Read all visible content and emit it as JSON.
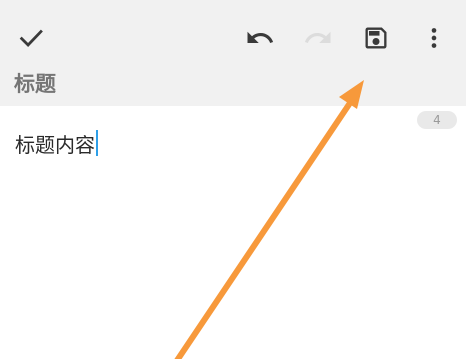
{
  "toolbar": {
    "done_icon": "checkmark-icon",
    "undo_icon": "undo-icon",
    "redo_icon": "redo-icon",
    "save_icon": "save-floppy-icon",
    "more_icon": "more-vertical-icon",
    "icon_color": "#3a3a3a",
    "disabled_icon_color": "#dcdcdc"
  },
  "note": {
    "title_placeholder": "标题",
    "content": "标题内容",
    "char_count": "4"
  },
  "annotation": {
    "arrow_color": "#f7993b",
    "points_to": "save-button"
  },
  "colors": {
    "header_bg": "#f1f1f1",
    "cursor": "#2e9fe8"
  }
}
